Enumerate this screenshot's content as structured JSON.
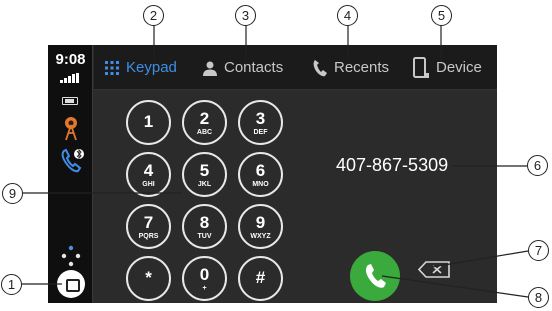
{
  "status": {
    "time": "9:08"
  },
  "tabs": [
    {
      "label": "Keypad",
      "icon": "keypad-grid-icon",
      "active": true
    },
    {
      "label": "Contacts",
      "icon": "person-icon",
      "active": false
    },
    {
      "label": "Recents",
      "icon": "phone-handset-icon",
      "active": false
    },
    {
      "label": "Device",
      "icon": "smartphone-icon",
      "active": false
    }
  ],
  "keypad": [
    {
      "digit": "1",
      "letters": ""
    },
    {
      "digit": "2",
      "letters": "ABC"
    },
    {
      "digit": "3",
      "letters": "DEF"
    },
    {
      "digit": "4",
      "letters": "GHI"
    },
    {
      "digit": "5",
      "letters": "JKL"
    },
    {
      "digit": "6",
      "letters": "MNO"
    },
    {
      "digit": "7",
      "letters": "PQRS"
    },
    {
      "digit": "8",
      "letters": "TUV"
    },
    {
      "digit": "9",
      "letters": "WXYZ"
    },
    {
      "digit": "*",
      "letters": ""
    },
    {
      "digit": "0",
      "letters": "+"
    },
    {
      "digit": "#",
      "letters": ""
    }
  ],
  "dialed_number": "407-867-5309",
  "callouts": [
    "1",
    "2",
    "3",
    "4",
    "5",
    "6",
    "7",
    "8",
    "9"
  ],
  "colors": {
    "accent": "#3d8ee6",
    "call": "#3aaa3c",
    "background": "#2b2b2b",
    "sidebar": "#0f0f0f"
  }
}
